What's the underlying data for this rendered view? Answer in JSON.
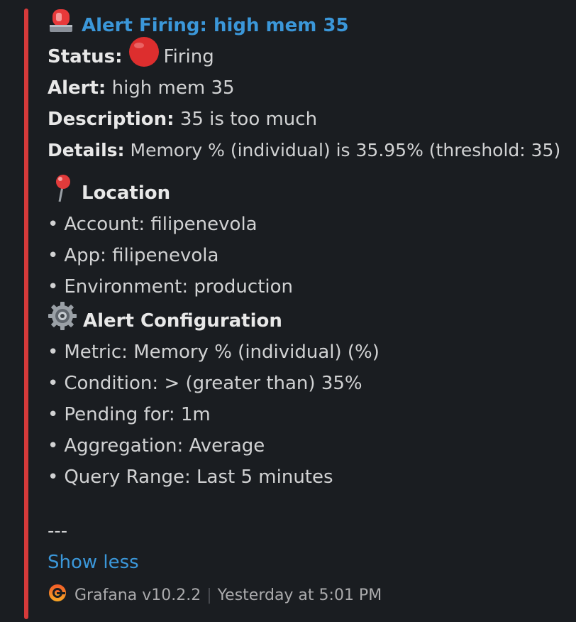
{
  "alert": {
    "title": "Alert Firing: high mem 35",
    "status_label": "Status:",
    "status_value": "Firing",
    "alert_label": "Alert:",
    "alert_value": "high mem 35",
    "description_label": "Description:",
    "description_value": "35 is too much",
    "details_label": "Details:",
    "details_value": "Memory % (individual) is 35.95% (threshold: 35)"
  },
  "location": {
    "heading": "Location",
    "items": [
      "Account: filipenevola",
      "App: filipenevola",
      "Environment: production"
    ]
  },
  "config": {
    "heading": "Alert Configuration",
    "items": [
      "Metric: Memory % (individual) (%)",
      "Condition: > (greater than) 35%",
      "Pending for: 1m",
      "Aggregation: Average",
      "Query Range: Last 5 minutes"
    ]
  },
  "divider_text": "---",
  "show_less_label": "Show less",
  "footer": {
    "app_name": "Grafana v10.2.2",
    "separator": "|",
    "timestamp": "Yesterday at 5:01 PM"
  },
  "icons": {
    "title": "rotating-light-icon",
    "status": "red-circle-icon",
    "location": "round-pushpin-icon",
    "config": "gear-icon",
    "footer": "grafana-logo-icon"
  },
  "colors": {
    "background": "#1a1d21",
    "accent_bar": "#d63a3a",
    "link": "#3b97d9",
    "text": "#d1d2d3"
  }
}
